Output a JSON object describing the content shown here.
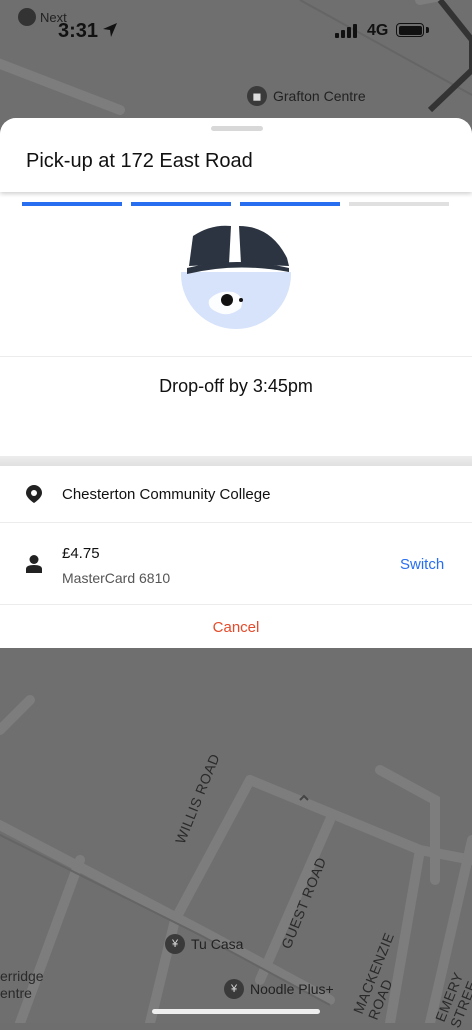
{
  "status_bar": {
    "back_app": "Next",
    "time": "3:31",
    "network": "4G"
  },
  "map": {
    "labels": {
      "grafton": "Grafton Centre",
      "willis": "WILLIS ROAD",
      "guest": "GUEST ROAD",
      "mackenzie": "MACKENZIE ROAD",
      "emery": "EMERY STREE",
      "tucasa": "Tu Casa",
      "noodle": "Noodle Plus+",
      "cherridge_1": "erridge",
      "cherridge_2": "entre"
    }
  },
  "sheet": {
    "title": "Pick-up at 172 East Road",
    "progress": {
      "steps_total": 4,
      "steps_complete": 3
    },
    "dropoff": "Drop-off by 3:45pm",
    "destination": "Chesterton Community College",
    "payment": {
      "price": "£4.75",
      "card": "MasterCard 6810",
      "switch_label": "Switch"
    },
    "cancel_label": "Cancel"
  },
  "icons": {
    "location": "location-pin-icon",
    "person": "person-icon",
    "nav": "location-arrow-icon"
  },
  "colors": {
    "accent": "#276ef1",
    "cancel": "#e54b2b",
    "map_bg": "#6e6e6e"
  }
}
